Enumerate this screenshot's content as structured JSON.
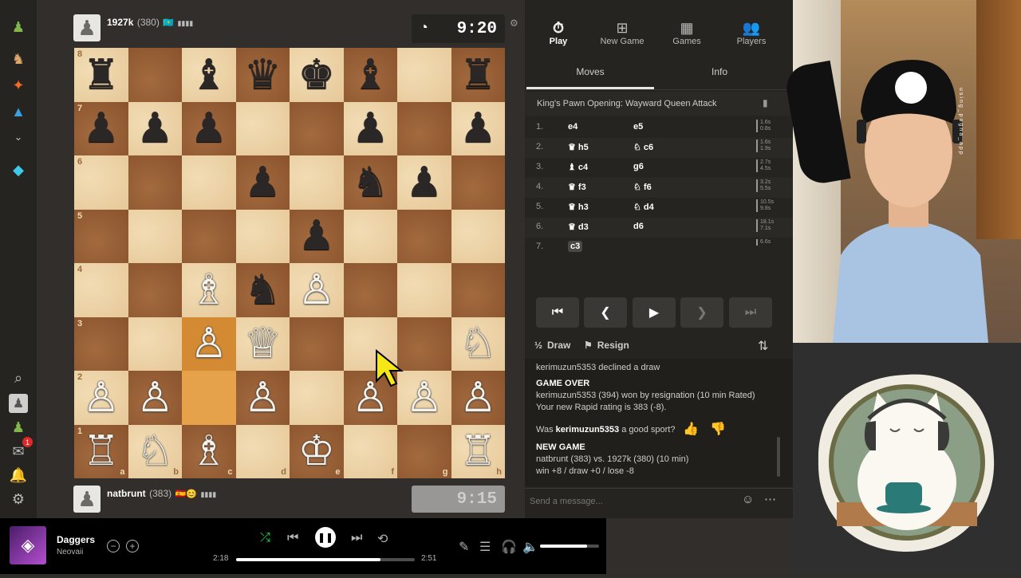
{
  "top_player": {
    "name": "1927k",
    "rating": "(380)",
    "flag": "🇰🇿",
    "clock": "9:20"
  },
  "bottom_player": {
    "name": "natbrunt",
    "rating": "(383)",
    "flags": "🇪🇸😊",
    "clock": "9:15"
  },
  "board": {
    "ranks": [
      "8",
      "7",
      "6",
      "5",
      "4",
      "3",
      "2",
      "1"
    ],
    "files": [
      "a",
      "b",
      "c",
      "d",
      "e",
      "f",
      "g",
      "h"
    ],
    "rows": [
      [
        "♜",
        "",
        "♝",
        "♛",
        "♚",
        "♝",
        "",
        "♜"
      ],
      [
        "♟",
        "♟",
        "♟",
        "",
        "",
        "♟",
        "",
        "♟"
      ],
      [
        "",
        "",
        "",
        "♟",
        "",
        "♞",
        "♟",
        ""
      ],
      [
        "",
        "",
        "",
        "",
        "♟",
        "",
        "",
        ""
      ],
      [
        "",
        "",
        "♗",
        "♞",
        "♙",
        "",
        "",
        ""
      ],
      [
        "",
        "",
        "♙",
        "♕",
        "",
        "",
        "",
        "♘"
      ],
      [
        "♙",
        "♙",
        "",
        "♙",
        "",
        "♙",
        "♙",
        "♙"
      ],
      [
        "♖",
        "♘",
        "♗",
        "",
        "♔",
        "",
        "",
        "♖"
      ]
    ],
    "colors": [
      [
        "b",
        "",
        "b",
        "b",
        "b",
        "b",
        "",
        "b"
      ],
      [
        "b",
        "b",
        "b",
        "",
        "",
        "b",
        "",
        "b"
      ],
      [
        "",
        "",
        "",
        "b",
        "",
        "b",
        "b",
        ""
      ],
      [
        "",
        "",
        "",
        "",
        "b",
        "",
        "",
        ""
      ],
      [
        "",
        "",
        "w",
        "b",
        "w",
        "",
        "",
        ""
      ],
      [
        "",
        "",
        "w",
        "w",
        "",
        "",
        "",
        "w"
      ],
      [
        "w",
        "w",
        "",
        "w",
        "",
        "w",
        "w",
        "w"
      ],
      [
        "w",
        "w",
        "w",
        "",
        "w",
        "",
        "",
        "w"
      ]
    ],
    "highlight_from": "c2",
    "highlight_to": "c3"
  },
  "nav": {
    "play": "Play",
    "new_game": "New Game",
    "games": "Games",
    "players": "Players"
  },
  "tabs": {
    "moves": "Moves",
    "info": "Info"
  },
  "opening": "King's Pawn Opening: Wayward Queen Attack",
  "moves": [
    {
      "num": "1.",
      "white": "e4",
      "black": "e5",
      "wt": "1.6s",
      "bt": "0.8s",
      "wi": "",
      "bi": ""
    },
    {
      "num": "2.",
      "white": "h5",
      "black": "c6",
      "wt": "1.6s",
      "bt": "1.9s",
      "wi": "♛",
      "bi": "♘"
    },
    {
      "num": "3.",
      "white": "c4",
      "black": "g6",
      "wt": "2.7s",
      "bt": "4.5s",
      "wi": "♝",
      "bi": ""
    },
    {
      "num": "4.",
      "white": "f3",
      "black": "f6",
      "wt": "3.2s",
      "bt": "5.5s",
      "wi": "♛",
      "bi": "♘"
    },
    {
      "num": "5.",
      "white": "h3",
      "black": "d4",
      "wt": "10.5s",
      "bt": "9.8s",
      "wi": "♛",
      "bi": "♘"
    },
    {
      "num": "6.",
      "white": "d3",
      "black": "d6",
      "wt": "18.1s",
      "bt": "7.1s",
      "wi": "♛",
      "bi": ""
    },
    {
      "num": "7.",
      "white": "c3",
      "black": "",
      "wt": "6.6s",
      "bt": "",
      "wi": "",
      "bi": ""
    }
  ],
  "actions": {
    "draw": "Draw",
    "resign": "Resign"
  },
  "chat": {
    "declined": "kerimuzun5353 declined a draw",
    "game_over": "GAME OVER",
    "result": "kerimuzun5353 (394) won by resignation (10 min Rated)",
    "rating": "Your new Rapid rating is 383 (-8).",
    "sport_prefix": "Was",
    "sport_name": "kerimuzun5353",
    "sport_suffix": "a good sport?",
    "new_game": "NEW GAME",
    "matchup": "natbrunt (383) vs. 1927k (380) (10 min)",
    "odds": "win +8 / draw +0 / lose -8",
    "placeholder": "Send a message..."
  },
  "music": {
    "title": "Daggers",
    "artist": "Neovaii",
    "elapsed": "2:18",
    "duration": "2:51",
    "progress": 0.81,
    "volume": 0.8
  },
  "stream_text": "using_pugna_app"
}
